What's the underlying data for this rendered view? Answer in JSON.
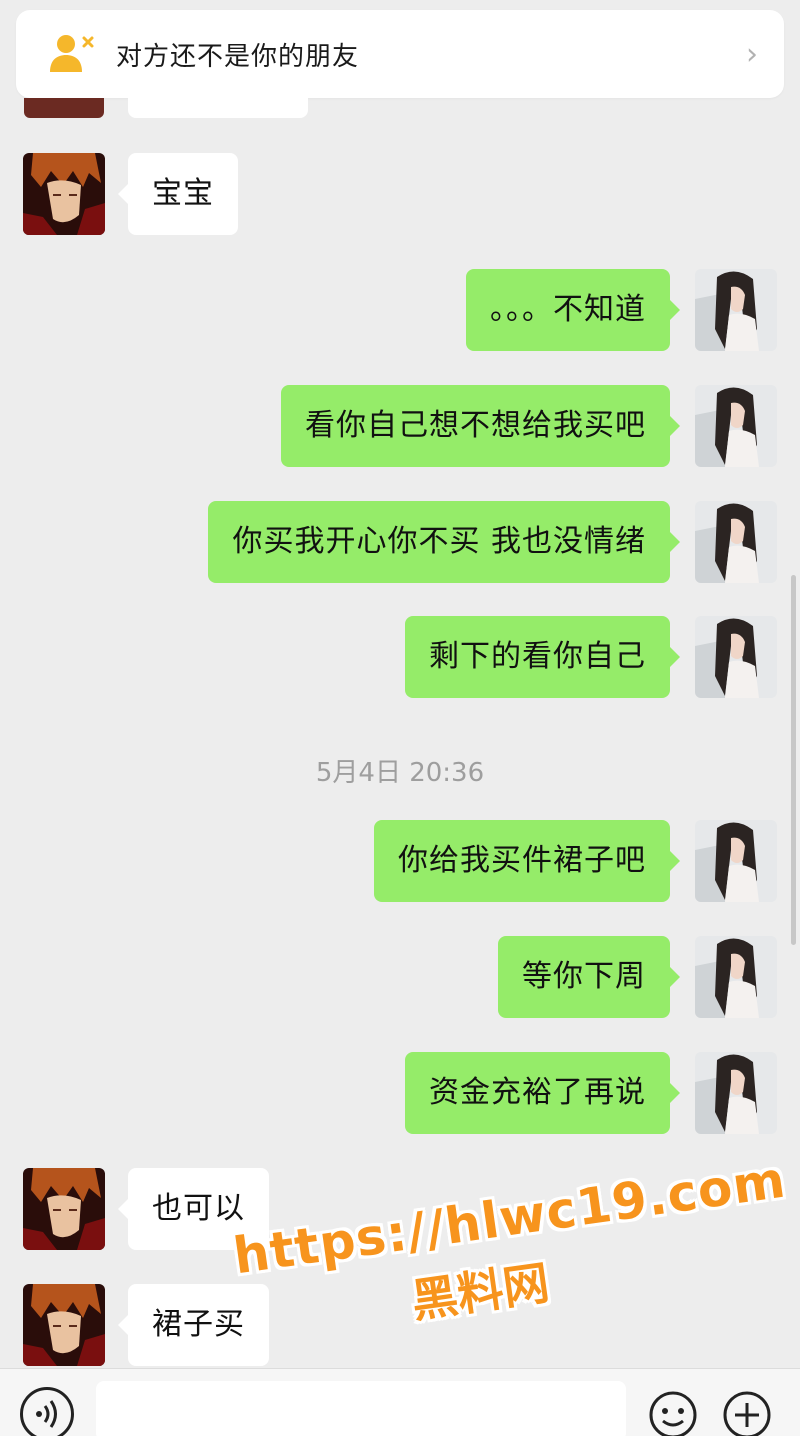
{
  "banner": {
    "text": "对方还不是你的朋友",
    "chevron": "›"
  },
  "colors": {
    "self_bubble": "#95ec69",
    "other_bubble": "#ffffff",
    "background": "#ededed",
    "watermark": "#f7941d"
  },
  "messages": [
    {
      "side": "left",
      "text": "宝宝"
    },
    {
      "side": "right",
      "text": "。。。不知道"
    },
    {
      "side": "right",
      "text": "看你自己想不想给我买吧"
    },
    {
      "side": "right",
      "text": "你买我开心你不买 我也没情绪"
    },
    {
      "side": "right",
      "text": "剩下的看你自己"
    },
    {
      "side": "right",
      "text": "你给我买件裙子吧"
    },
    {
      "side": "right",
      "text": "等你下周"
    },
    {
      "side": "right",
      "text": "资金充裕了再说"
    },
    {
      "side": "left",
      "text": "也可以"
    },
    {
      "side": "left",
      "text": "裙子买"
    }
  ],
  "timestamp": "5月4日 20:36",
  "watermark": {
    "line1": "https://hlwc19.com",
    "line2": "黑料网"
  },
  "icons": {
    "banner": "user-cross-icon",
    "voice": "voice-icon",
    "emoji": "emoji-icon",
    "plus": "plus-icon"
  }
}
